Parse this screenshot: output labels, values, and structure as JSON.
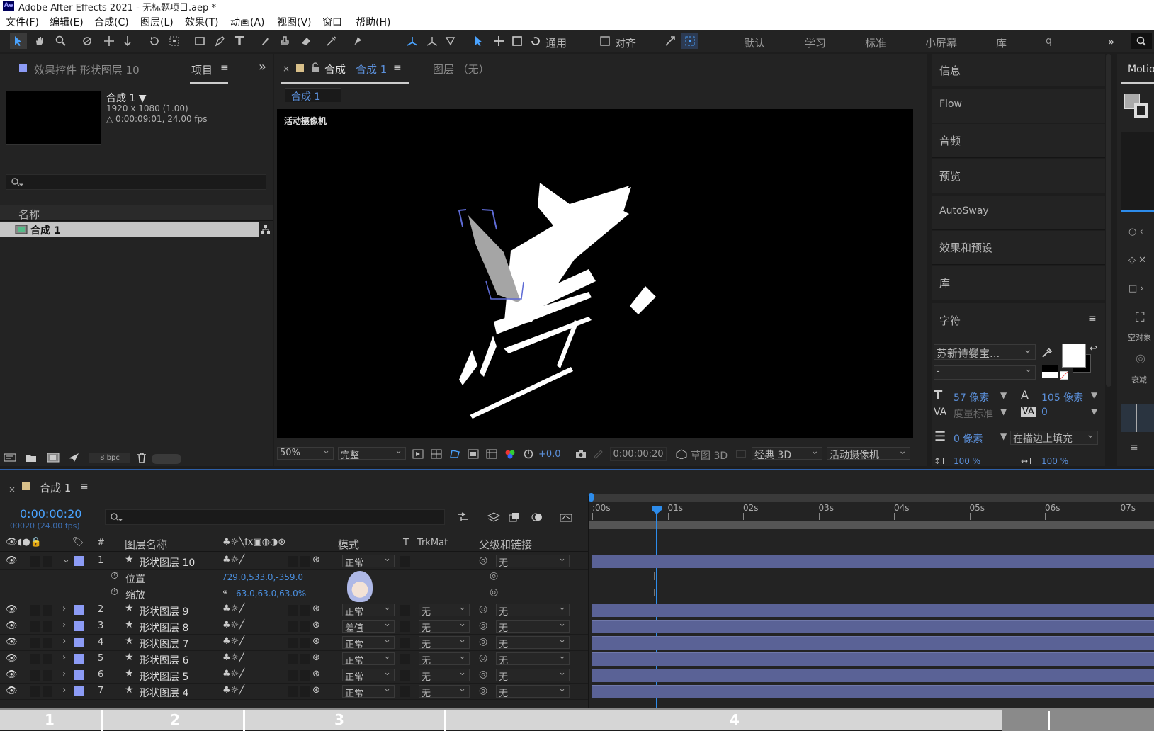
{
  "app": {
    "title": "Adobe After Effects 2021 - 无标题项目.aep *",
    "logo": "Ae"
  },
  "menu": [
    "文件(F)",
    "编辑(E)",
    "合成(C)",
    "图层(L)",
    "效果(T)",
    "动画(A)",
    "视图(V)",
    "窗口",
    "帮助(H)"
  ],
  "toolbar": {
    "universal": "通用",
    "align": "对齐",
    "workspaces": [
      "默认",
      "学习",
      "标准",
      "小屏幕",
      "库"
    ],
    "search_hint": "q"
  },
  "left_panel": {
    "tab_effects": "效果控件 形状图层 10",
    "tab_project": "项目",
    "comp_name": "合成 1 ▼",
    "comp_size": "1920 x 1080 (1.00)",
    "comp_duration": "△ 0:00:09:01, 24.00 fps",
    "col_name": "名称",
    "item": "合成 1",
    "bpc": "8 bpc"
  },
  "comp_panel": {
    "tab_comp_prefix": "合成",
    "tab_comp_name": "合成 1",
    "tab_layer": "图层 （无）",
    "sub_tab": "合成 1",
    "camera_label": "活动摄像机",
    "zoom": "50%",
    "quality": "完整",
    "exposure": "+0.0",
    "timecode": "0:00:00:20",
    "draft3d": "草图 3D",
    "renderer": "经典 3D",
    "camera": "活动摄像机"
  },
  "right_panel": {
    "items": [
      "信息",
      "Flow",
      "音频",
      "预览",
      "AutoSway",
      "效果和预设",
      "库"
    ],
    "char_title": "字符",
    "font": "苏新诗爨宝...",
    "font_style": "-",
    "size": "57 像素",
    "leading": "105 像素",
    "kerning": "度量标准",
    "tracking": "0",
    "stroke_width": "0 像素",
    "stroke_mode": "在描边上填充",
    "scale_v": "100 %",
    "scale_h": "100 %"
  },
  "far_right": {
    "tab": "Motio",
    "null_label": "空对象",
    "mode_label": "衰减"
  },
  "timeline": {
    "tab": "合成 1",
    "timecode": "0:00:00:20",
    "frames": "00020 (24.00 fps)",
    "headers": {
      "num": "#",
      "name": "图层名称",
      "mode": "模式",
      "t": "T",
      "trkmat": "TrkMat",
      "parent": "父级和链接"
    },
    "ruler": [
      ":00s",
      "01s",
      "02s",
      "03s",
      "04s",
      "05s",
      "06s",
      "07s"
    ],
    "layers": [
      {
        "num": "1",
        "name": "形状图层 10",
        "mode": "正常",
        "trkmat": "",
        "parent": "无"
      },
      {
        "num": "2",
        "name": "形状图层 9",
        "mode": "正常",
        "trkmat": "无",
        "parent": "无"
      },
      {
        "num": "3",
        "name": "形状图层 8",
        "mode": "差值",
        "trkmat": "无",
        "parent": "无"
      },
      {
        "num": "4",
        "name": "形状图层 7",
        "mode": "正常",
        "trkmat": "无",
        "parent": "无"
      },
      {
        "num": "5",
        "name": "形状图层 6",
        "mode": "正常",
        "trkmat": "无",
        "parent": "无"
      },
      {
        "num": "6",
        "name": "形状图层 5",
        "mode": "正常",
        "trkmat": "无",
        "parent": "无"
      },
      {
        "num": "7",
        "name": "形状图层 4",
        "mode": "正常",
        "trkmat": "无",
        "parent": "无"
      }
    ],
    "props": [
      {
        "name": "位置",
        "value": "729.0,533.0,-359.0"
      },
      {
        "name": "缩放",
        "value": "63.0,63.0,63.0%"
      }
    ]
  },
  "bottom_strip": [
    "1",
    "2",
    "3",
    "4"
  ],
  "colors": {
    "label_blue": "#8c9bf5",
    "accent": "#2d8ceb",
    "bar": "#5a6296"
  }
}
